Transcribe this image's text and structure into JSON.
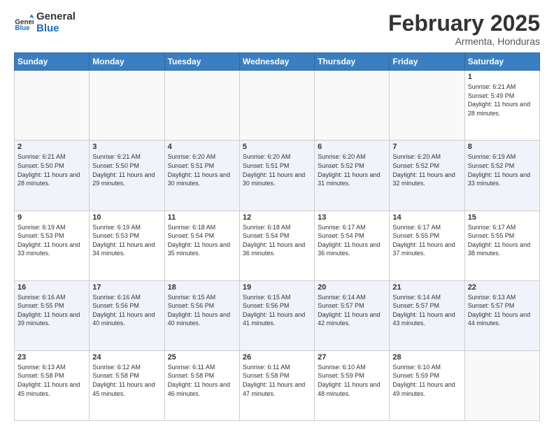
{
  "logo": {
    "line1": "General",
    "line2": "Blue"
  },
  "header": {
    "month": "February 2025",
    "location": "Armenta, Honduras"
  },
  "weekdays": [
    "Sunday",
    "Monday",
    "Tuesday",
    "Wednesday",
    "Thursday",
    "Friday",
    "Saturday"
  ],
  "weeks": [
    [
      {
        "day": "",
        "info": ""
      },
      {
        "day": "",
        "info": ""
      },
      {
        "day": "",
        "info": ""
      },
      {
        "day": "",
        "info": ""
      },
      {
        "day": "",
        "info": ""
      },
      {
        "day": "",
        "info": ""
      },
      {
        "day": "1",
        "info": "Sunrise: 6:21 AM\nSunset: 5:49 PM\nDaylight: 11 hours and 28 minutes."
      }
    ],
    [
      {
        "day": "2",
        "info": "Sunrise: 6:21 AM\nSunset: 5:50 PM\nDaylight: 11 hours and 28 minutes."
      },
      {
        "day": "3",
        "info": "Sunrise: 6:21 AM\nSunset: 5:50 PM\nDaylight: 11 hours and 29 minutes."
      },
      {
        "day": "4",
        "info": "Sunrise: 6:20 AM\nSunset: 5:51 PM\nDaylight: 11 hours and 30 minutes."
      },
      {
        "day": "5",
        "info": "Sunrise: 6:20 AM\nSunset: 5:51 PM\nDaylight: 11 hours and 30 minutes."
      },
      {
        "day": "6",
        "info": "Sunrise: 6:20 AM\nSunset: 5:52 PM\nDaylight: 11 hours and 31 minutes."
      },
      {
        "day": "7",
        "info": "Sunrise: 6:20 AM\nSunset: 5:52 PM\nDaylight: 11 hours and 32 minutes."
      },
      {
        "day": "8",
        "info": "Sunrise: 6:19 AM\nSunset: 5:52 PM\nDaylight: 11 hours and 33 minutes."
      }
    ],
    [
      {
        "day": "9",
        "info": "Sunrise: 6:19 AM\nSunset: 5:53 PM\nDaylight: 11 hours and 33 minutes."
      },
      {
        "day": "10",
        "info": "Sunrise: 6:19 AM\nSunset: 5:53 PM\nDaylight: 11 hours and 34 minutes."
      },
      {
        "day": "11",
        "info": "Sunrise: 6:18 AM\nSunset: 5:54 PM\nDaylight: 11 hours and 35 minutes."
      },
      {
        "day": "12",
        "info": "Sunrise: 6:18 AM\nSunset: 5:54 PM\nDaylight: 11 hours and 36 minutes."
      },
      {
        "day": "13",
        "info": "Sunrise: 6:17 AM\nSunset: 5:54 PM\nDaylight: 11 hours and 36 minutes."
      },
      {
        "day": "14",
        "info": "Sunrise: 6:17 AM\nSunset: 5:55 PM\nDaylight: 11 hours and 37 minutes."
      },
      {
        "day": "15",
        "info": "Sunrise: 6:17 AM\nSunset: 5:55 PM\nDaylight: 11 hours and 38 minutes."
      }
    ],
    [
      {
        "day": "16",
        "info": "Sunrise: 6:16 AM\nSunset: 5:55 PM\nDaylight: 11 hours and 39 minutes."
      },
      {
        "day": "17",
        "info": "Sunrise: 6:16 AM\nSunset: 5:56 PM\nDaylight: 11 hours and 40 minutes."
      },
      {
        "day": "18",
        "info": "Sunrise: 6:15 AM\nSunset: 5:56 PM\nDaylight: 11 hours and 40 minutes."
      },
      {
        "day": "19",
        "info": "Sunrise: 6:15 AM\nSunset: 5:56 PM\nDaylight: 11 hours and 41 minutes."
      },
      {
        "day": "20",
        "info": "Sunrise: 6:14 AM\nSunset: 5:57 PM\nDaylight: 11 hours and 42 minutes."
      },
      {
        "day": "21",
        "info": "Sunrise: 6:14 AM\nSunset: 5:57 PM\nDaylight: 11 hours and 43 minutes."
      },
      {
        "day": "22",
        "info": "Sunrise: 6:13 AM\nSunset: 5:57 PM\nDaylight: 11 hours and 44 minutes."
      }
    ],
    [
      {
        "day": "23",
        "info": "Sunrise: 6:13 AM\nSunset: 5:58 PM\nDaylight: 11 hours and 45 minutes."
      },
      {
        "day": "24",
        "info": "Sunrise: 6:12 AM\nSunset: 5:58 PM\nDaylight: 11 hours and 45 minutes."
      },
      {
        "day": "25",
        "info": "Sunrise: 6:11 AM\nSunset: 5:58 PM\nDaylight: 11 hours and 46 minutes."
      },
      {
        "day": "26",
        "info": "Sunrise: 6:11 AM\nSunset: 5:58 PM\nDaylight: 11 hours and 47 minutes."
      },
      {
        "day": "27",
        "info": "Sunrise: 6:10 AM\nSunset: 5:59 PM\nDaylight: 11 hours and 48 minutes."
      },
      {
        "day": "28",
        "info": "Sunrise: 6:10 AM\nSunset: 5:59 PM\nDaylight: 11 hours and 49 minutes."
      },
      {
        "day": "",
        "info": ""
      }
    ]
  ]
}
